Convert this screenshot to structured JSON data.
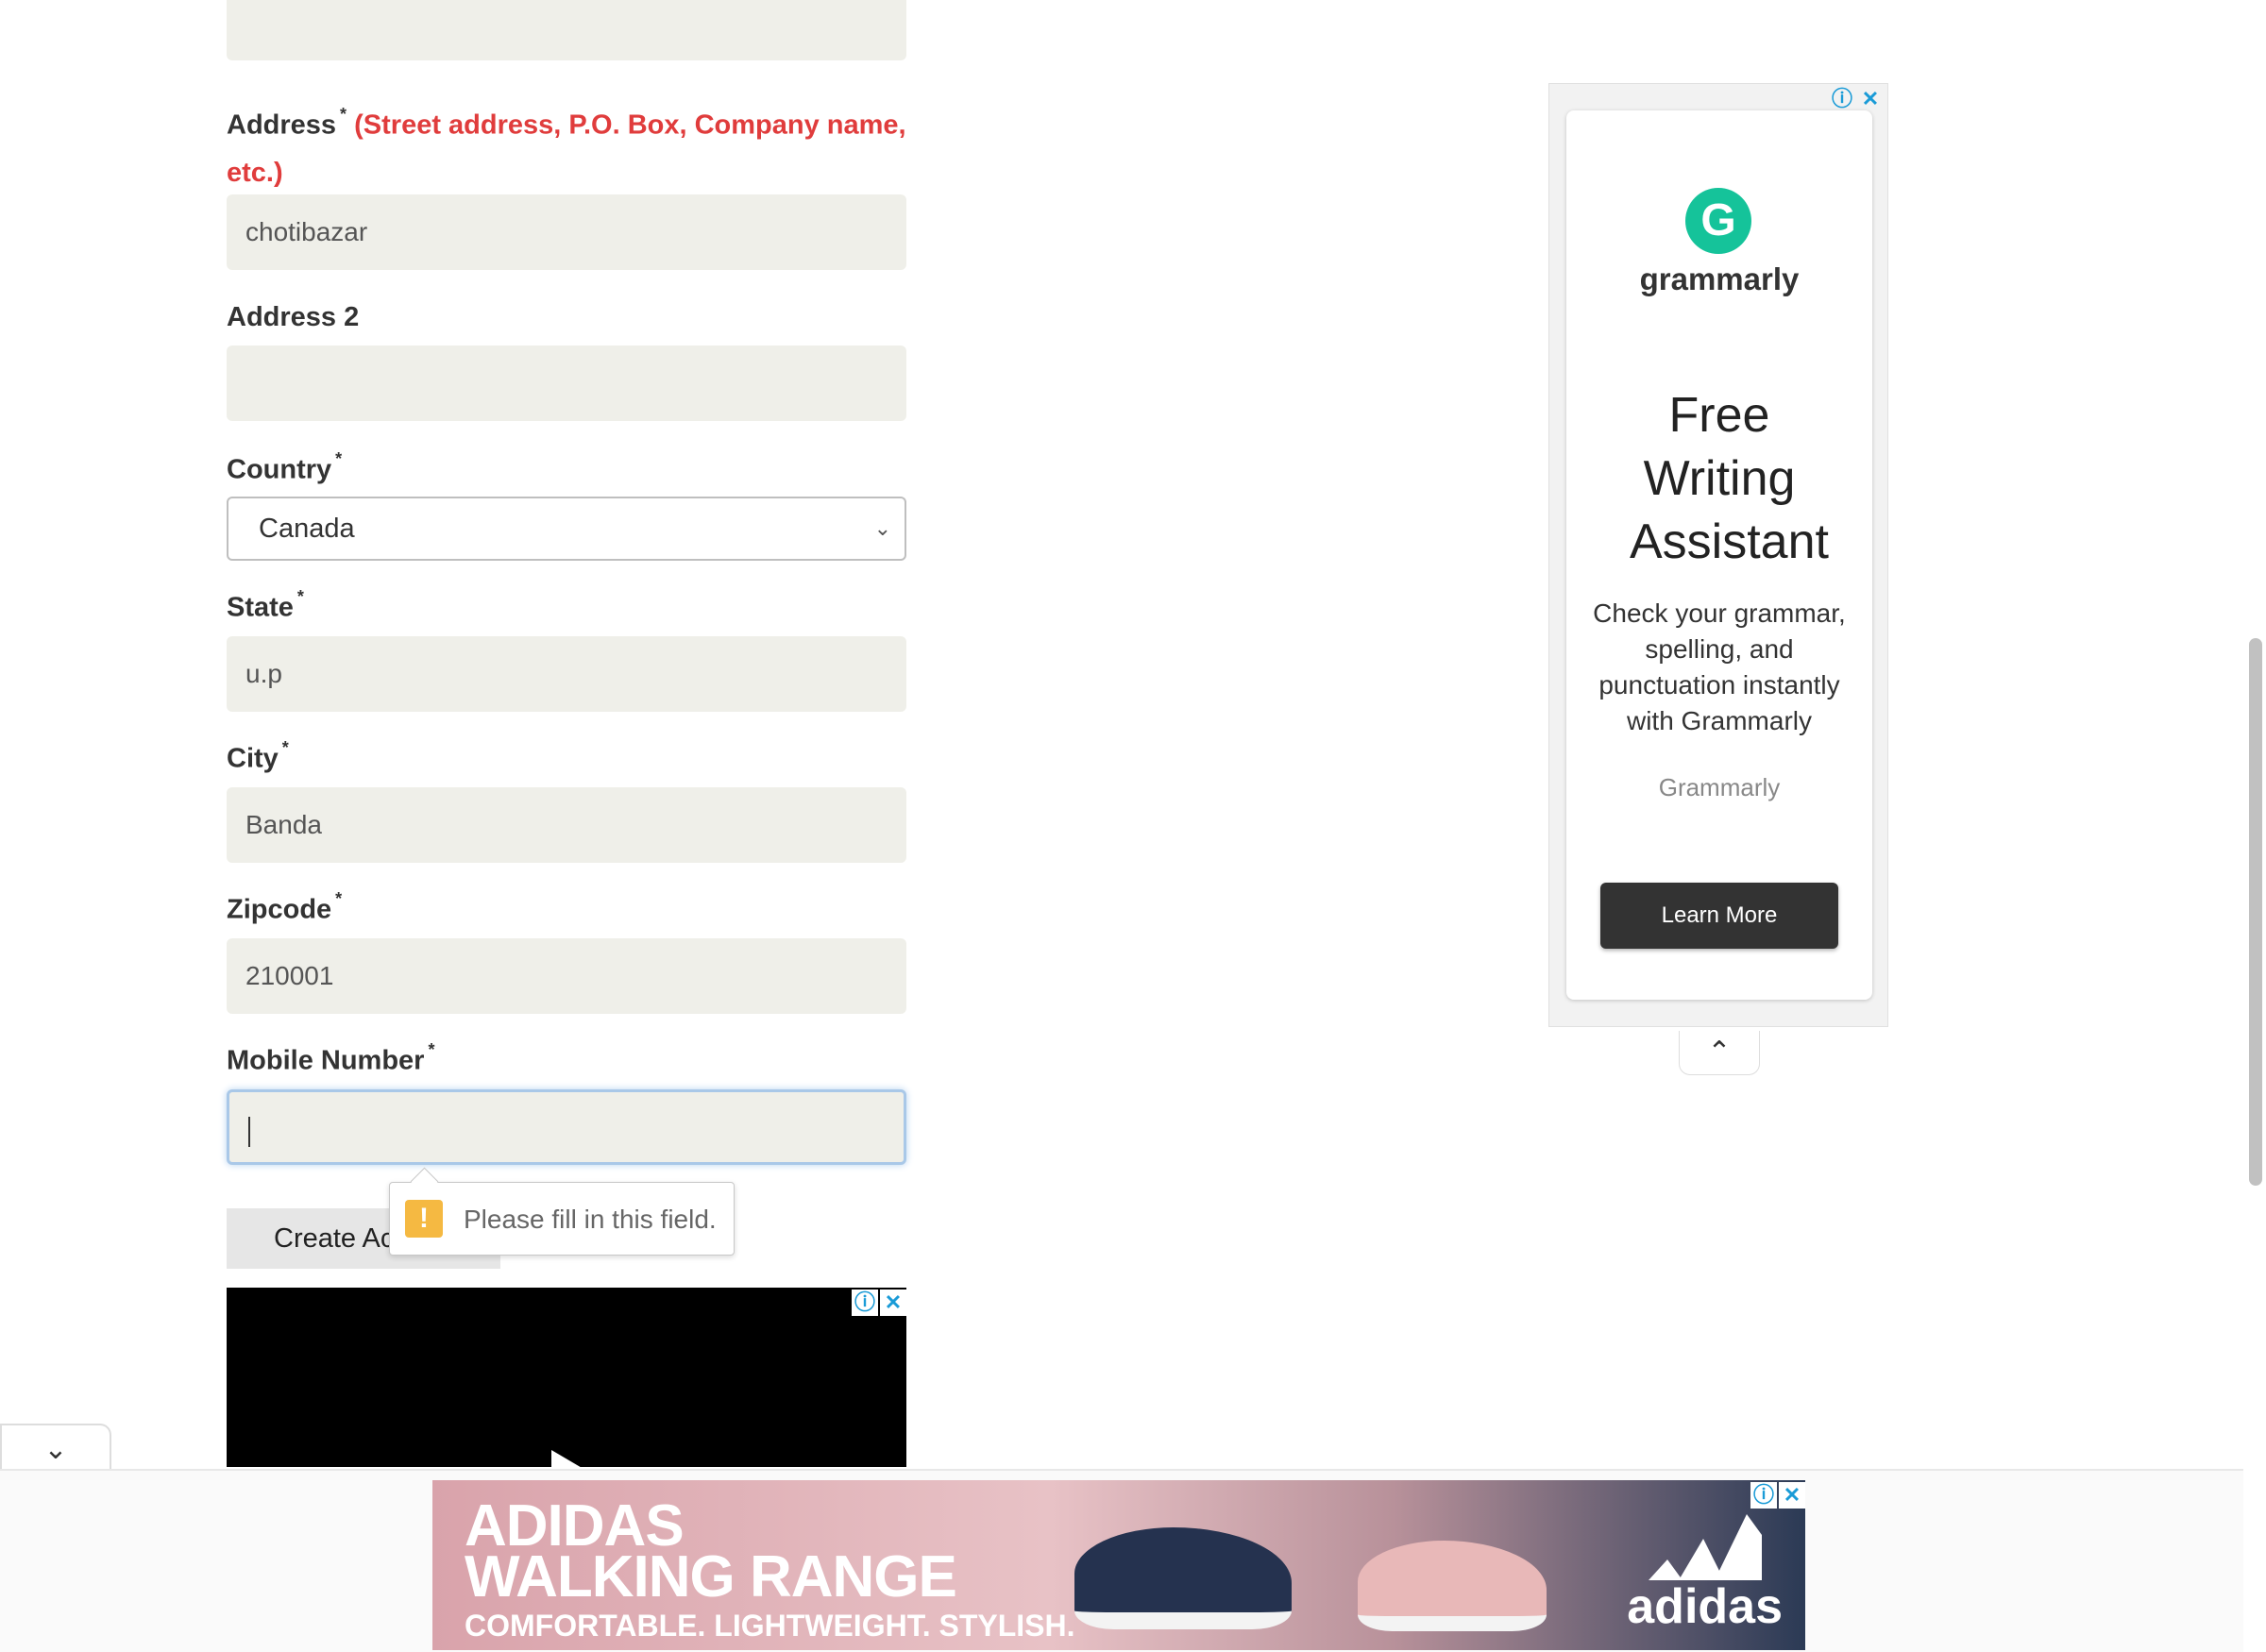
{
  "form": {
    "address_label": "Address",
    "required_mark": "*",
    "address_hint": "(Street address, P.O. Box, Company name, etc.)",
    "address_value": "chotibazar",
    "address2_label": "Address 2",
    "address2_value": "",
    "country_label": "Country",
    "country_value": "Canada",
    "state_label": "State",
    "state_value": "u.p",
    "city_label": "City",
    "city_value": "Banda",
    "zipcode_label": "Zipcode",
    "zipcode_value": "210001",
    "mobile_label": "Mobile Number",
    "mobile_value": "",
    "create_button": "Create Account",
    "validation_message": "Please fill in this field."
  },
  "side_ad": {
    "brand_word": "grammarly",
    "headline": "Free Writing Assistant",
    "body": "Check your grammar, spelling, and punctuation instantly with Grammarly",
    "brand": "Grammarly",
    "cta": "Learn More"
  },
  "banner_ad": {
    "line1": "ADIDAS",
    "line2": "WALKING RANGE",
    "line3": "COMFORTABLE. LIGHTWEIGHT. STYLISH.",
    "logo_word": "adidas"
  },
  "icons": {
    "ad_info": "info-icon",
    "ad_close": "close-icon",
    "chevron_down": "chevron-down-icon",
    "chevron_up": "chevron-up-icon",
    "warning": "warning-icon"
  },
  "colors": {
    "hint_red": "#e03c3c",
    "field_bg": "#efefe9",
    "grammarly_green": "#15c39a"
  }
}
